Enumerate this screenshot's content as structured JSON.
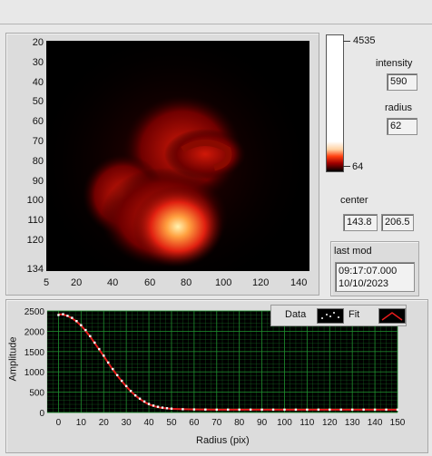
{
  "image_panel": {
    "y_ticks": [
      "20",
      "30",
      "40",
      "50",
      "60",
      "70",
      "80",
      "90",
      "100",
      "110",
      "120",
      "134"
    ],
    "x_ticks": [
      "5",
      "20",
      "40",
      "60",
      "80",
      "100",
      "120",
      "140"
    ]
  },
  "colorbar": {
    "max_label": "4535",
    "min_label": "64"
  },
  "indicators": {
    "intensity_label": "intensity",
    "intensity_value": "590",
    "radius_label": "radius",
    "radius_value": "62",
    "center_label": "center",
    "center_x": "143.8",
    "center_y": "206.5",
    "last_mod_label": "last mod",
    "last_mod_time": "09:17:07.000",
    "last_mod_date": "10/10/2023"
  },
  "plot": {
    "legend": {
      "data_label": "Data",
      "fit_label": "Fit"
    },
    "colors": {
      "background": "#000000",
      "grid": "#1f8f2f",
      "data": "#ffffff",
      "fit": "#e81c1c"
    }
  },
  "chart_data": {
    "type": "line",
    "title": "",
    "xlabel": "Radius (pix)",
    "ylabel": "Amplitude",
    "xlim": [
      -5,
      150
    ],
    "ylim": [
      0,
      2500
    ],
    "x_ticks": [
      0,
      10,
      20,
      30,
      40,
      50,
      60,
      70,
      80,
      90,
      100,
      110,
      120,
      130,
      140,
      150
    ],
    "y_ticks": [
      0,
      500,
      1000,
      1500,
      2000,
      2500
    ],
    "grid": true,
    "legend_position": "top-right",
    "series": [
      {
        "name": "Data",
        "style": "points",
        "x": [
          0,
          2,
          4,
          6,
          8,
          10,
          12,
          14,
          16,
          18,
          20,
          22,
          24,
          26,
          28,
          30,
          32,
          34,
          36,
          38,
          40,
          42,
          44,
          46,
          48,
          50,
          55,
          60,
          65,
          70,
          75,
          80,
          85,
          90,
          95,
          100,
          105,
          110,
          115,
          120,
          125,
          130,
          135,
          140,
          145,
          150
        ],
        "y": [
          2400,
          2420,
          2380,
          2330,
          2250,
          2150,
          2030,
          1880,
          1720,
          1560,
          1400,
          1230,
          1070,
          920,
          780,
          650,
          530,
          420,
          340,
          270,
          210,
          170,
          140,
          120,
          105,
          95,
          80,
          75,
          72,
          70,
          70,
          70,
          70,
          70,
          70,
          70,
          70,
          70,
          70,
          70,
          70,
          70,
          70,
          70,
          70,
          70
        ]
      },
      {
        "name": "Fit",
        "style": "line",
        "x": [
          0,
          2,
          4,
          6,
          8,
          10,
          12,
          14,
          16,
          18,
          20,
          22,
          24,
          26,
          28,
          30,
          32,
          34,
          36,
          38,
          40,
          42,
          44,
          46,
          48,
          50,
          55,
          60,
          65,
          70,
          80,
          90,
          100,
          110,
          120,
          130,
          140,
          150
        ],
        "y": [
          2420,
          2410,
          2380,
          2320,
          2240,
          2140,
          2010,
          1870,
          1710,
          1550,
          1390,
          1220,
          1060,
          910,
          770,
          640,
          520,
          420,
          330,
          260,
          200,
          160,
          130,
          110,
          100,
          90,
          80,
          75,
          72,
          70,
          70,
          70,
          70,
          70,
          70,
          70,
          70,
          70
        ]
      }
    ]
  }
}
